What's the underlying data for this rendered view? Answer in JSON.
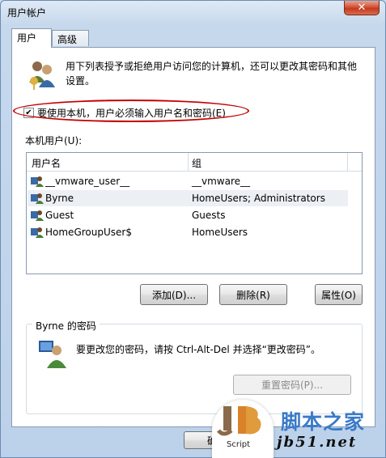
{
  "window": {
    "title": "用户帐户",
    "close_glyph": "✕"
  },
  "tabs": [
    {
      "label": "用户",
      "active": true
    },
    {
      "label": "高级",
      "active": false
    }
  ],
  "description": "用下列表授予或拒绝用户访问您的计算机，还可以更改其密码和其他设置。",
  "require_login": {
    "label": "要使用本机，用户必须输入用户名和密码(E)",
    "checked": true,
    "check_glyph": "✔"
  },
  "local_users": {
    "label": "本机用户(U):",
    "columns": [
      "用户名",
      "组"
    ],
    "rows": [
      {
        "name": "__vmware_user__",
        "group": "__vmware__"
      },
      {
        "name": "Byrne",
        "group": "HomeUsers; Administrators"
      },
      {
        "name": "Guest",
        "group": "Guests"
      },
      {
        "name": "HomeGroupUser$",
        "group": "HomeUsers"
      }
    ]
  },
  "buttons": {
    "add": "添加(D)...",
    "remove": "删除(R)",
    "properties": "属性(O)"
  },
  "password_group": {
    "title": "Byrne 的密码",
    "text": "要更改您的密码，请按 Ctrl-Alt-Del 并选择“更改密码”。",
    "reset_button": "重置密码(P)..."
  },
  "footer": {
    "ok_partial": "确"
  },
  "watermark": {
    "brand_cn": "脚本之家",
    "url": "jb51.net",
    "script": "Script"
  },
  "colors": {
    "accent": "#3a7ac8",
    "ellipse": "#c40000",
    "close": "#c43b1d"
  }
}
